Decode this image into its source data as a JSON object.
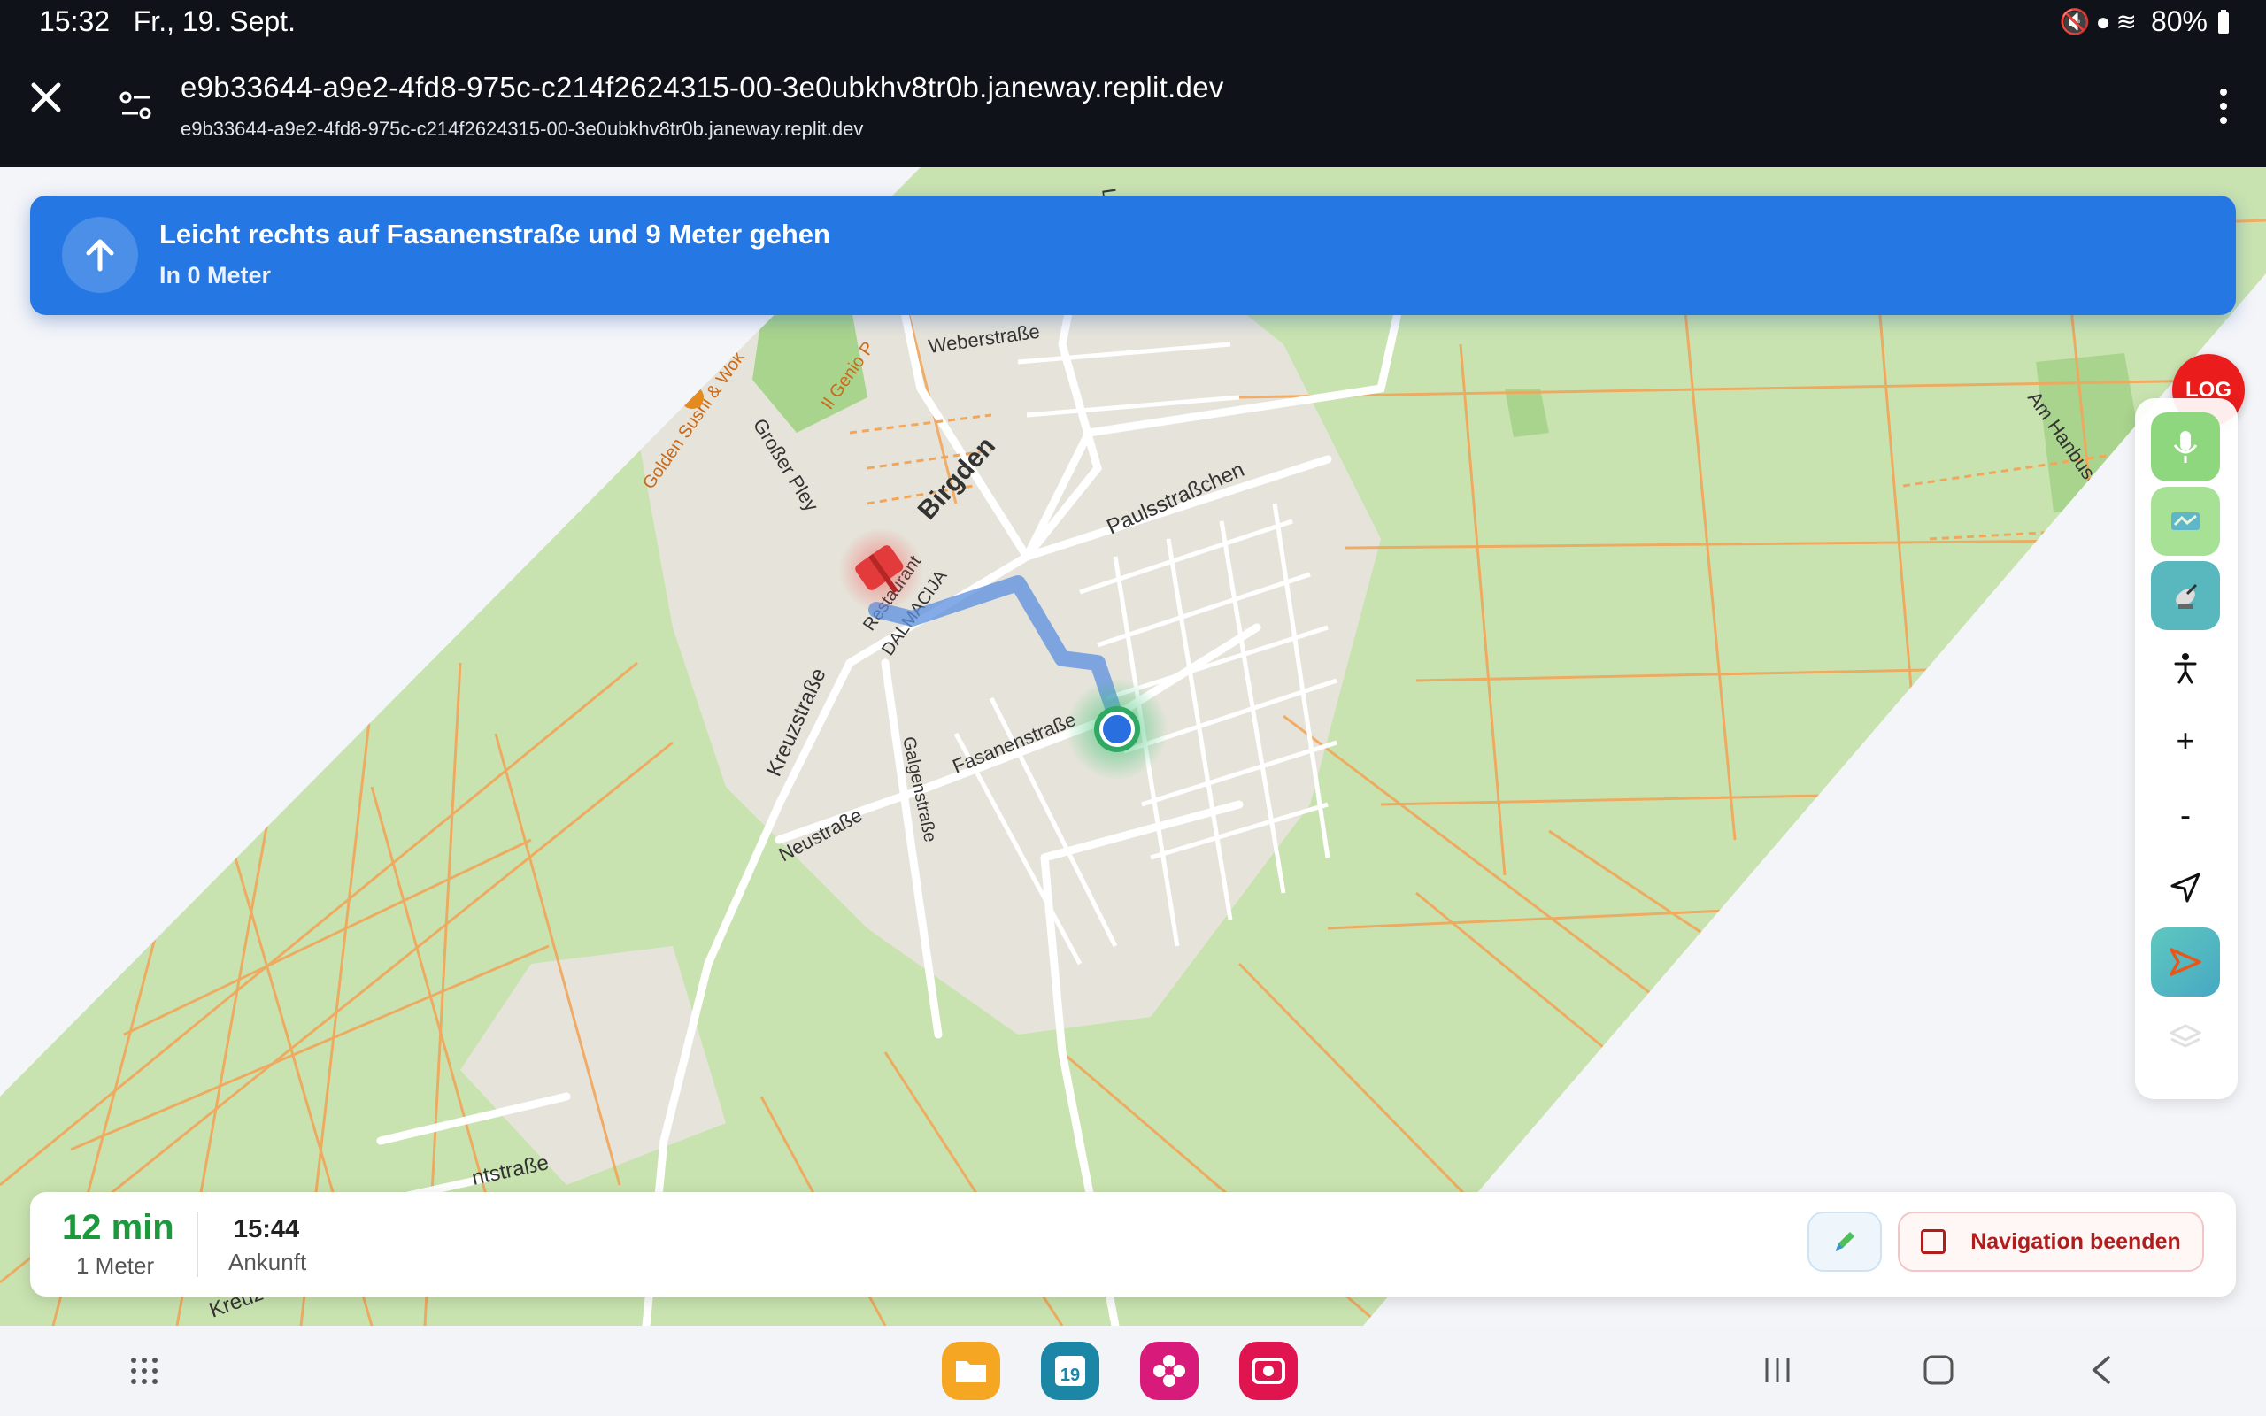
{
  "status_bar": {
    "time": "15:32",
    "date": "Fr., 19. Sept.",
    "battery": "80%"
  },
  "browser": {
    "url_title": "e9b33644-a9e2-4fd8-975c-c214f2624315-00-3e0ubkhv8tr0b.janeway.replit.dev",
    "url_subtitle": "e9b33644-a9e2-4fd8-975c-c214f2624315-00-3e0ubkhv8tr0b.janeway.replit.dev"
  },
  "instruction": {
    "title": "Leicht rechts auf Fasanenstraße und 9 Meter gehen",
    "distance": "In 0 Meter"
  },
  "map_labels": {
    "weberstrasse": "Weberstraße",
    "birgden": "Birgden",
    "paulsstraesschen": "Paulsstraßchen",
    "am_hanbusch": "Am Hanbusch",
    "golden_sushi": "Golden Sushi & Wok",
    "il_genio": "Il Genio P",
    "grosser_pley": "Großer Pley",
    "restaurant": "Restaurant",
    "dalmacija": "DALMACIJA",
    "kreuzstrasse": "Kreuzstraße",
    "fasanenstrasse": "Fasanenstraße",
    "galgenstrasse": "Galgenstraße",
    "neustrasse": "Neustraße",
    "ntstrasse": "ntstraße",
    "kreuz": "Kreuz",
    "lipp": "Lipp"
  },
  "controls": {
    "log_label": "LOG",
    "zoom_in": "+",
    "zoom_out": "-"
  },
  "trip": {
    "eta_minutes": "12 min",
    "remaining_distance": "1 Meter",
    "arrival_time": "15:44",
    "arrival_label": "Ankunft",
    "end_button": "Navigation beenden"
  },
  "dock": {
    "calendar_day": "19"
  },
  "colors": {
    "banner": "#2577e3",
    "eta_green": "#1b9a3c",
    "log_red": "#ea1c1c",
    "end_red": "#b01d1d",
    "map_field": "#c9e3b0",
    "map_town": "#e5e3d8",
    "road_orange": "#f2a65a",
    "route_blue": "#5b8fe0"
  }
}
